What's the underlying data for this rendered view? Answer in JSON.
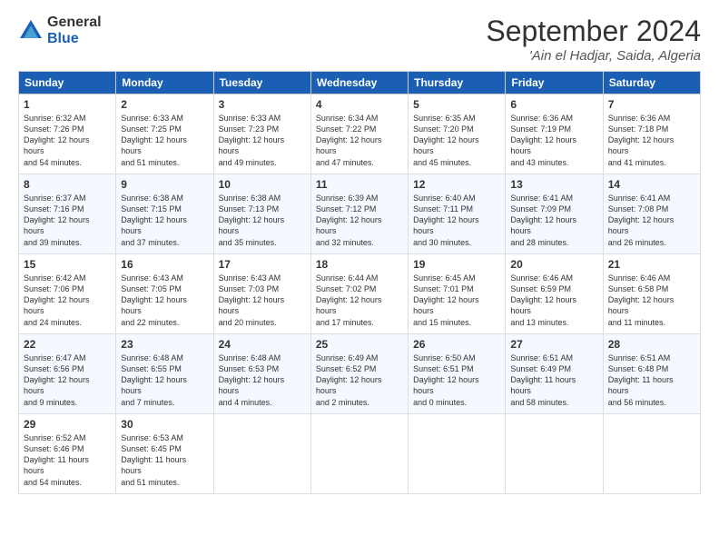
{
  "logo": {
    "general": "General",
    "blue": "Blue"
  },
  "title": "September 2024",
  "location": "'Ain el Hadjar, Saida, Algeria",
  "headers": [
    "Sunday",
    "Monday",
    "Tuesday",
    "Wednesday",
    "Thursday",
    "Friday",
    "Saturday"
  ],
  "weeks": [
    [
      {
        "day": "1",
        "sunrise": "6:32 AM",
        "sunset": "7:26 PM",
        "daylight": "12 hours and 54 minutes."
      },
      {
        "day": "2",
        "sunrise": "6:33 AM",
        "sunset": "7:25 PM",
        "daylight": "12 hours and 51 minutes."
      },
      {
        "day": "3",
        "sunrise": "6:33 AM",
        "sunset": "7:23 PM",
        "daylight": "12 hours and 49 minutes."
      },
      {
        "day": "4",
        "sunrise": "6:34 AM",
        "sunset": "7:22 PM",
        "daylight": "12 hours and 47 minutes."
      },
      {
        "day": "5",
        "sunrise": "6:35 AM",
        "sunset": "7:20 PM",
        "daylight": "12 hours and 45 minutes."
      },
      {
        "day": "6",
        "sunrise": "6:36 AM",
        "sunset": "7:19 PM",
        "daylight": "12 hours and 43 minutes."
      },
      {
        "day": "7",
        "sunrise": "6:36 AM",
        "sunset": "7:18 PM",
        "daylight": "12 hours and 41 minutes."
      }
    ],
    [
      {
        "day": "8",
        "sunrise": "6:37 AM",
        "sunset": "7:16 PM",
        "daylight": "12 hours and 39 minutes."
      },
      {
        "day": "9",
        "sunrise": "6:38 AM",
        "sunset": "7:15 PM",
        "daylight": "12 hours and 37 minutes."
      },
      {
        "day": "10",
        "sunrise": "6:38 AM",
        "sunset": "7:13 PM",
        "daylight": "12 hours and 35 minutes."
      },
      {
        "day": "11",
        "sunrise": "6:39 AM",
        "sunset": "7:12 PM",
        "daylight": "12 hours and 32 minutes."
      },
      {
        "day": "12",
        "sunrise": "6:40 AM",
        "sunset": "7:11 PM",
        "daylight": "12 hours and 30 minutes."
      },
      {
        "day": "13",
        "sunrise": "6:41 AM",
        "sunset": "7:09 PM",
        "daylight": "12 hours and 28 minutes."
      },
      {
        "day": "14",
        "sunrise": "6:41 AM",
        "sunset": "7:08 PM",
        "daylight": "12 hours and 26 minutes."
      }
    ],
    [
      {
        "day": "15",
        "sunrise": "6:42 AM",
        "sunset": "7:06 PM",
        "daylight": "12 hours and 24 minutes."
      },
      {
        "day": "16",
        "sunrise": "6:43 AM",
        "sunset": "7:05 PM",
        "daylight": "12 hours and 22 minutes."
      },
      {
        "day": "17",
        "sunrise": "6:43 AM",
        "sunset": "7:03 PM",
        "daylight": "12 hours and 20 minutes."
      },
      {
        "day": "18",
        "sunrise": "6:44 AM",
        "sunset": "7:02 PM",
        "daylight": "12 hours and 17 minutes."
      },
      {
        "day": "19",
        "sunrise": "6:45 AM",
        "sunset": "7:01 PM",
        "daylight": "12 hours and 15 minutes."
      },
      {
        "day": "20",
        "sunrise": "6:46 AM",
        "sunset": "6:59 PM",
        "daylight": "12 hours and 13 minutes."
      },
      {
        "day": "21",
        "sunrise": "6:46 AM",
        "sunset": "6:58 PM",
        "daylight": "12 hours and 11 minutes."
      }
    ],
    [
      {
        "day": "22",
        "sunrise": "6:47 AM",
        "sunset": "6:56 PM",
        "daylight": "12 hours and 9 minutes."
      },
      {
        "day": "23",
        "sunrise": "6:48 AM",
        "sunset": "6:55 PM",
        "daylight": "12 hours and 7 minutes."
      },
      {
        "day": "24",
        "sunrise": "6:48 AM",
        "sunset": "6:53 PM",
        "daylight": "12 hours and 4 minutes."
      },
      {
        "day": "25",
        "sunrise": "6:49 AM",
        "sunset": "6:52 PM",
        "daylight": "12 hours and 2 minutes."
      },
      {
        "day": "26",
        "sunrise": "6:50 AM",
        "sunset": "6:51 PM",
        "daylight": "12 hours and 0 minutes."
      },
      {
        "day": "27",
        "sunrise": "6:51 AM",
        "sunset": "6:49 PM",
        "daylight": "11 hours and 58 minutes."
      },
      {
        "day": "28",
        "sunrise": "6:51 AM",
        "sunset": "6:48 PM",
        "daylight": "11 hours and 56 minutes."
      }
    ],
    [
      {
        "day": "29",
        "sunrise": "6:52 AM",
        "sunset": "6:46 PM",
        "daylight": "11 hours and 54 minutes."
      },
      {
        "day": "30",
        "sunrise": "6:53 AM",
        "sunset": "6:45 PM",
        "daylight": "11 hours and 51 minutes."
      },
      null,
      null,
      null,
      null,
      null
    ]
  ]
}
